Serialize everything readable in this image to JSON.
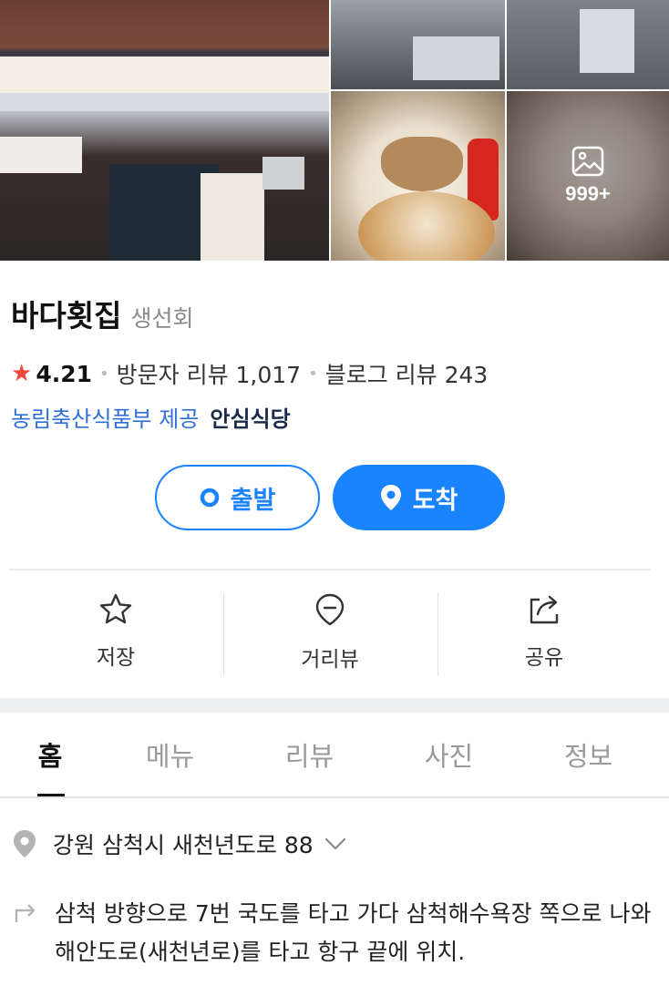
{
  "gallery": {
    "photo_count_label": "999+",
    "icon": "image-icon"
  },
  "place": {
    "name": "바다횟집",
    "category": "생선회"
  },
  "rating": {
    "icon": "star-icon",
    "score": "4.21",
    "visitor_reviews": "방문자 리뷰 1,017",
    "blog_reviews": "블로그 리뷰 243"
  },
  "certification": {
    "provider": "농림축산식품부 제공",
    "name": "안심식당"
  },
  "actions": {
    "start_label": "출발",
    "arrive_label": "도착"
  },
  "quick_actions": [
    {
      "label": "저장",
      "icon": "star-outline-icon"
    },
    {
      "label": "거리뷰",
      "icon": "map-pin-outline-icon"
    },
    {
      "label": "공유",
      "icon": "share-icon"
    }
  ],
  "tabs": [
    {
      "label": "홈",
      "active": true
    },
    {
      "label": "메뉴",
      "active": false
    },
    {
      "label": "리뷰",
      "active": false
    },
    {
      "label": "사진",
      "active": false
    },
    {
      "label": "정보",
      "active": false
    }
  ],
  "info": {
    "address": "강원 삼척시 새천년도로 88",
    "directions": "삼척 방향으로 7번 국도를 타고 가다 삼척해수욕장 쪽으로 나와 해안도로(새천년로)를 타고 항구 끝에 위치."
  },
  "colors": {
    "accent": "#1a84ff",
    "star": "#f0473f",
    "link": "#2f6fd6"
  }
}
